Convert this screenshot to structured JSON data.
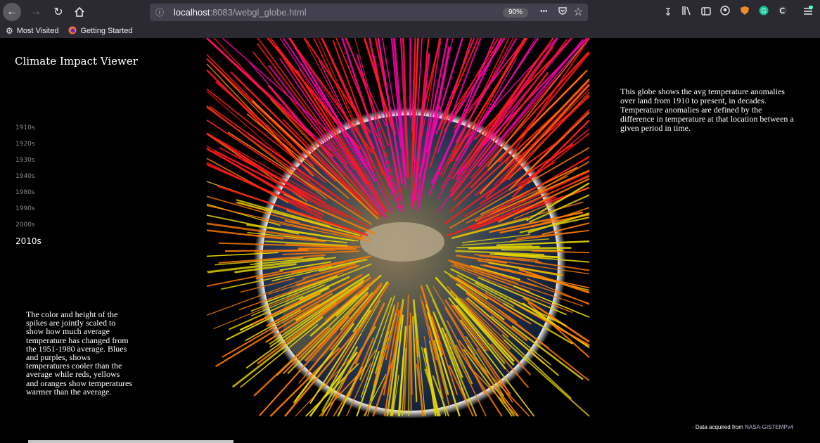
{
  "browser": {
    "url_host": "localhost",
    "url_rest": ":8083/webgl_globe.html",
    "zoom": "90%",
    "bookmarks": [
      {
        "label": "Most Visited",
        "icon": "gear-icon"
      },
      {
        "label": "Getting Started",
        "icon": "firefox-icon"
      }
    ],
    "ellipsis": "•••"
  },
  "page": {
    "title": "Climate Impact Viewer",
    "decades": [
      "1910s",
      "1920s",
      "1930s",
      "1940s",
      "1980s",
      "1990s",
      "2000s",
      "2010s"
    ],
    "active_decade": "2010s",
    "description_right": "This globe shows the avg temperature anomalies over land from 1910 to present, in decades. Temperature anomalies are defined by the difference in temperature at that location between a given period in time.",
    "description_left": "The color and height of the spikes are jointly scaled to show how much average temperature has changed from the 1951-1980 average. Blues and purples, shows temperatures cooler than the average while reds, yellows and oranges show temperatures warmer than the average.",
    "credit_prefix": "·   Data acquired from ",
    "credit_source": "NASA-GISTEMPv4"
  },
  "colors": {
    "background": "#000000",
    "spike_hot": "#ff1a1a",
    "spike_warm": "#ff7a00",
    "spike_mild": "#e5d400",
    "spike_extreme": "#ff00aa"
  }
}
